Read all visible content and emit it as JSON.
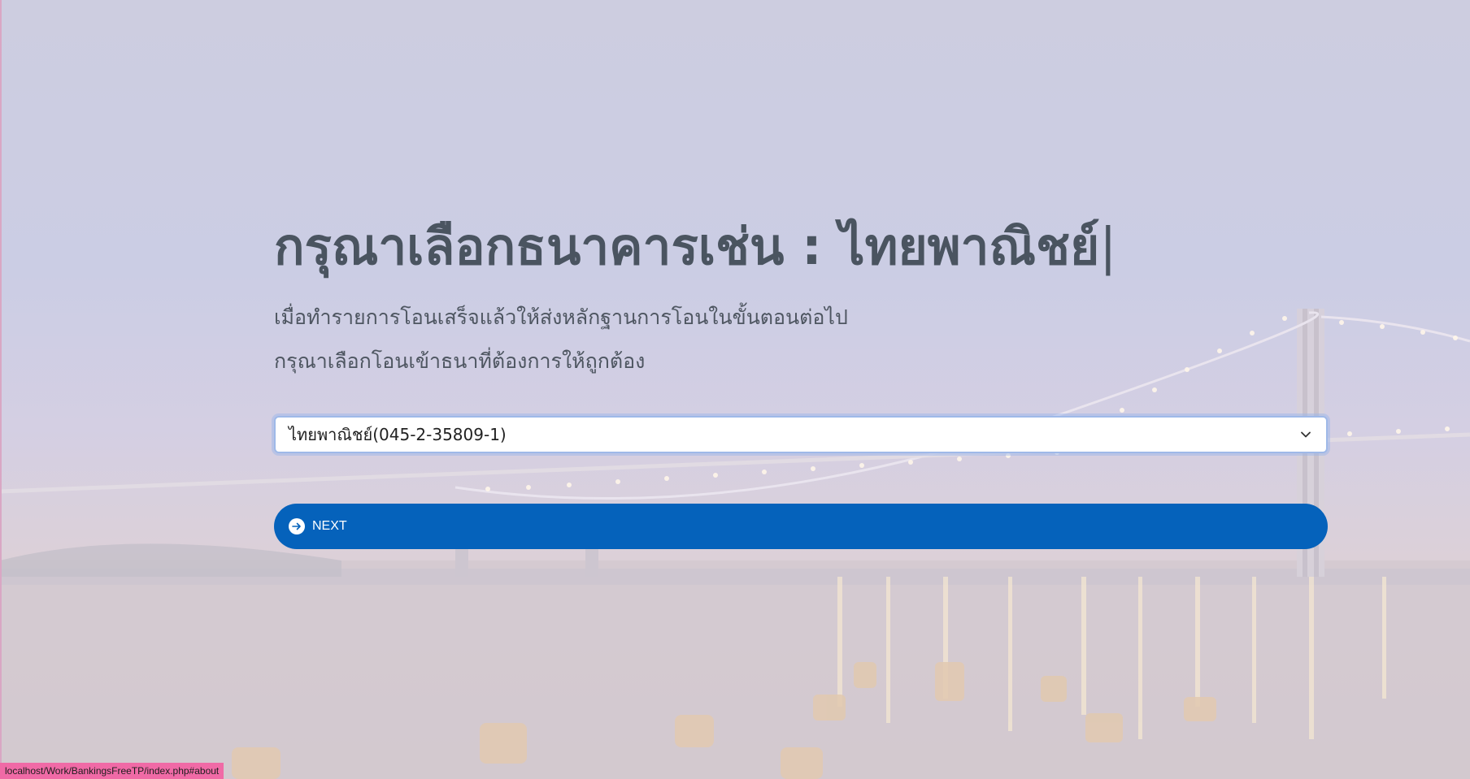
{
  "heading": {
    "prefix": "กรุณาเลือกธนาคารเช่น : ",
    "bank_name": "ไทยพาณิชย์",
    "cursor": "|"
  },
  "subtexts": [
    "เมื่อทำรายการโอนเสร็จแล้วให้ส่งหลักฐานการโอนในขั้นตอนต่อไป",
    "กรุณาเลือกโอนเข้าธนาที่ต้องการให้ถูกต้อง"
  ],
  "bank_select": {
    "selected": "ไทยพาณิชย์(045-2-35809-1)",
    "icon": "chevron-down-icon"
  },
  "next_button": {
    "label": "NEXT",
    "icon": "arrow-right-circle-icon"
  },
  "status_bar": {
    "url": "localhost/Work/BankingsFreeTP/index.php#about"
  },
  "colors": {
    "button": "#0562bb",
    "heading": "#4a5460",
    "status_bar_bg": "#f06aa6"
  }
}
